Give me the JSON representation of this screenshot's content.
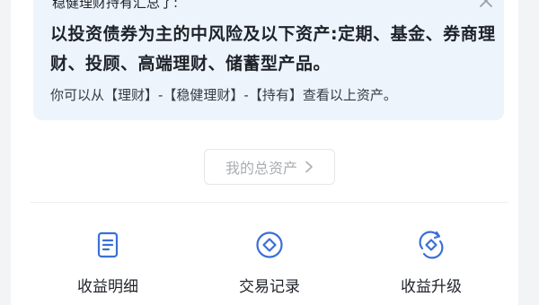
{
  "notice": {
    "clipped_text": "稳健理财持有汇总了:",
    "main_text": "以投资债券为主的中风险及以下资产:定期、基金、券商理财、投顾、高端理财、储蓄型产品。",
    "sub_text": "你可以从【理财】-【稳健理财】-【持有】查看以上资产。"
  },
  "total_assets": {
    "label": "我的总资产"
  },
  "actions": [
    {
      "label": "收益明细",
      "icon": "document-list-icon"
    },
    {
      "label": "交易记录",
      "icon": "diamond-circle-icon"
    },
    {
      "label": "收益升级",
      "icon": "upgrade-refresh-icon"
    }
  ],
  "colors": {
    "accent": "#3a6fd8",
    "notice_bg": "#eef4fc",
    "text_primary": "#1f2329",
    "text_muted": "#a9adb3"
  }
}
